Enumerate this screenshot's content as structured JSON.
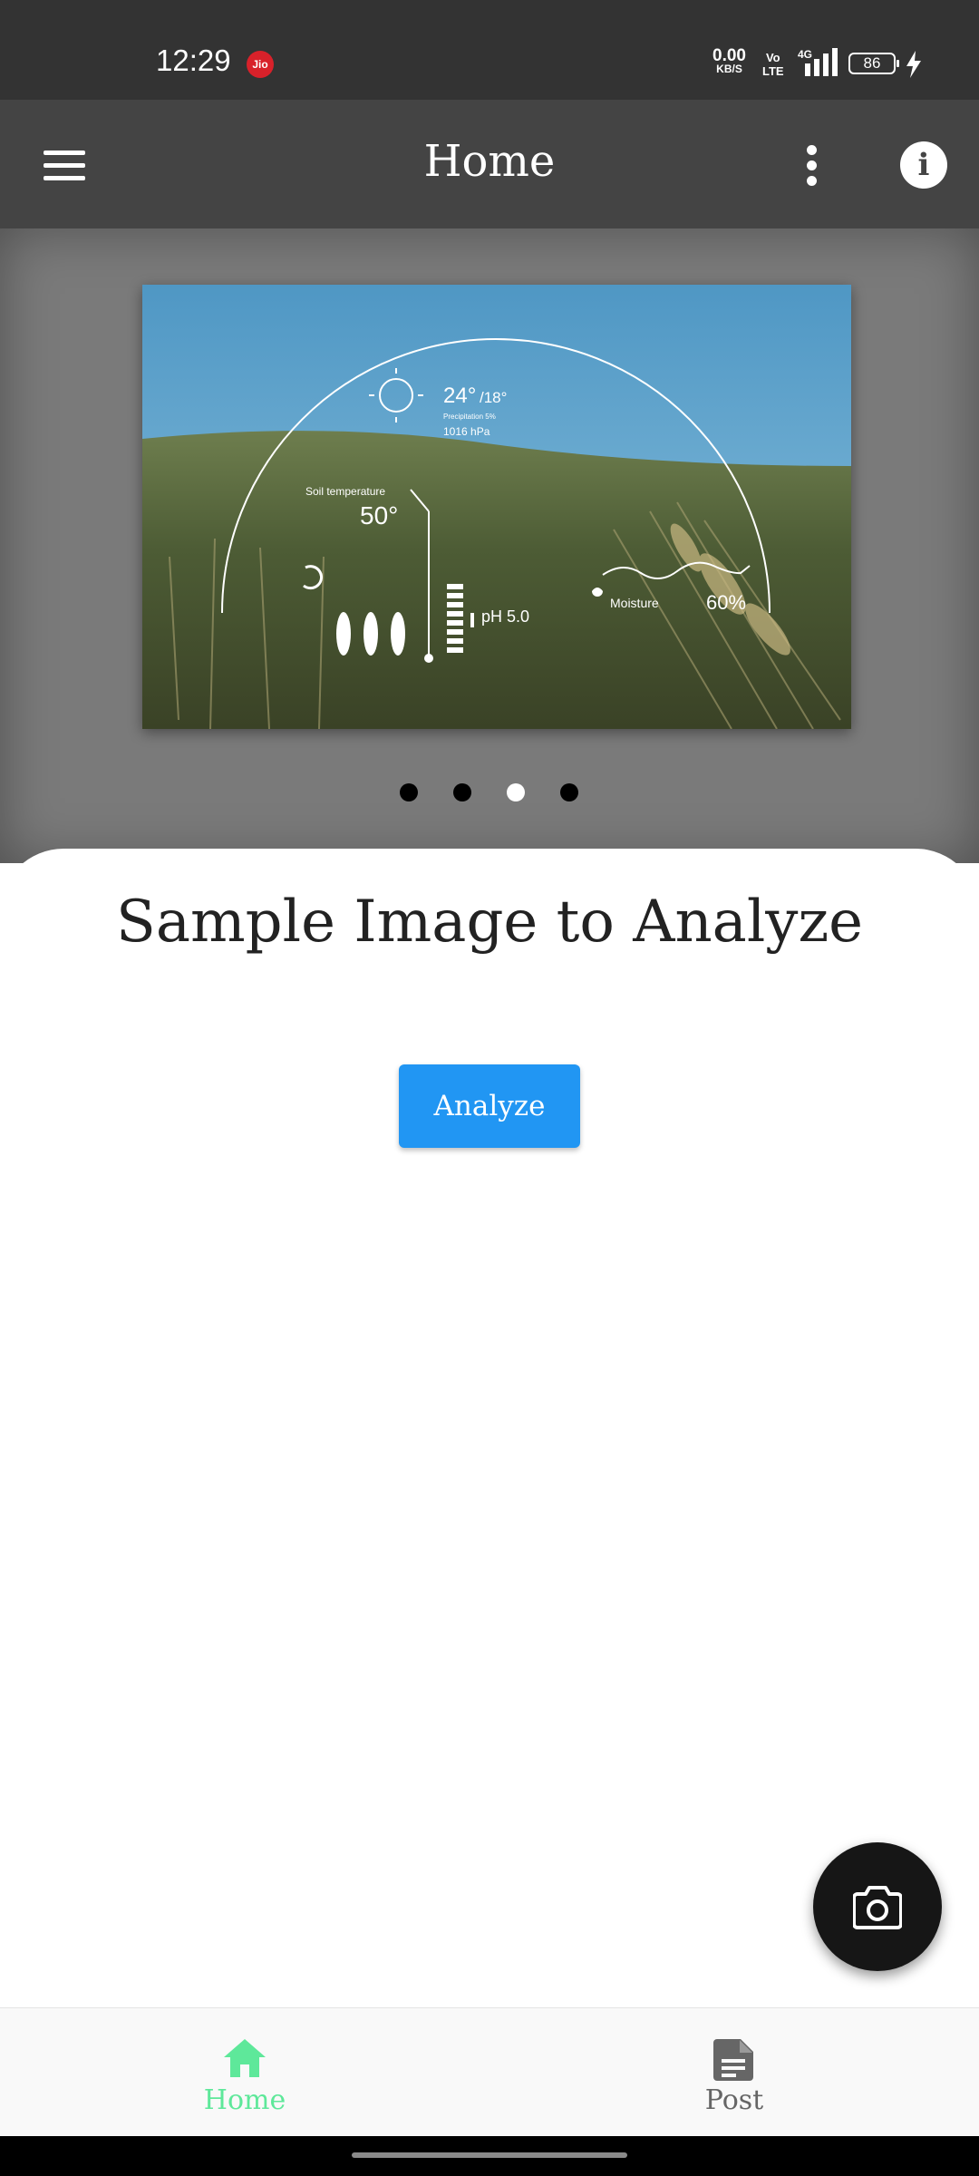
{
  "status_bar": {
    "time": "12:29",
    "carrier": "Jio",
    "net_speed_value": "0.00",
    "net_speed_unit": "KB/S",
    "volte_top": "Vo",
    "volte_bottom": "LTE",
    "network": "4G",
    "battery": "86"
  },
  "app_bar": {
    "title": "Home",
    "menu_icon": "hamburger-menu-icon",
    "more_icon": "more-vert-icon",
    "info_icon": "info-icon"
  },
  "carousel": {
    "image_overlay": {
      "temperature": "24°",
      "temperature_low": "/18°",
      "precipitation": "Precipitation 5%",
      "pressure": "1016 hPa",
      "soil_label": "Soil temperature",
      "soil_value": "50°",
      "ph": "pH 5.0",
      "moisture_label": "Moisture",
      "moisture_value": "60%"
    },
    "slide_count": 4,
    "active_index": 2
  },
  "sheet": {
    "title": "Sample Image to Analyze",
    "analyze_label": "Analyze"
  },
  "fab": {
    "icon": "camera-icon"
  },
  "bottom_nav": {
    "items": [
      {
        "label": "Home",
        "icon": "home-icon",
        "active": true
      },
      {
        "label": "Post",
        "icon": "document-icon",
        "active": false
      }
    ]
  },
  "colors": {
    "accent": "#2196f3",
    "nav_active": "#5ee89a",
    "app_bar": "#444444",
    "status_bar": "#333333"
  }
}
